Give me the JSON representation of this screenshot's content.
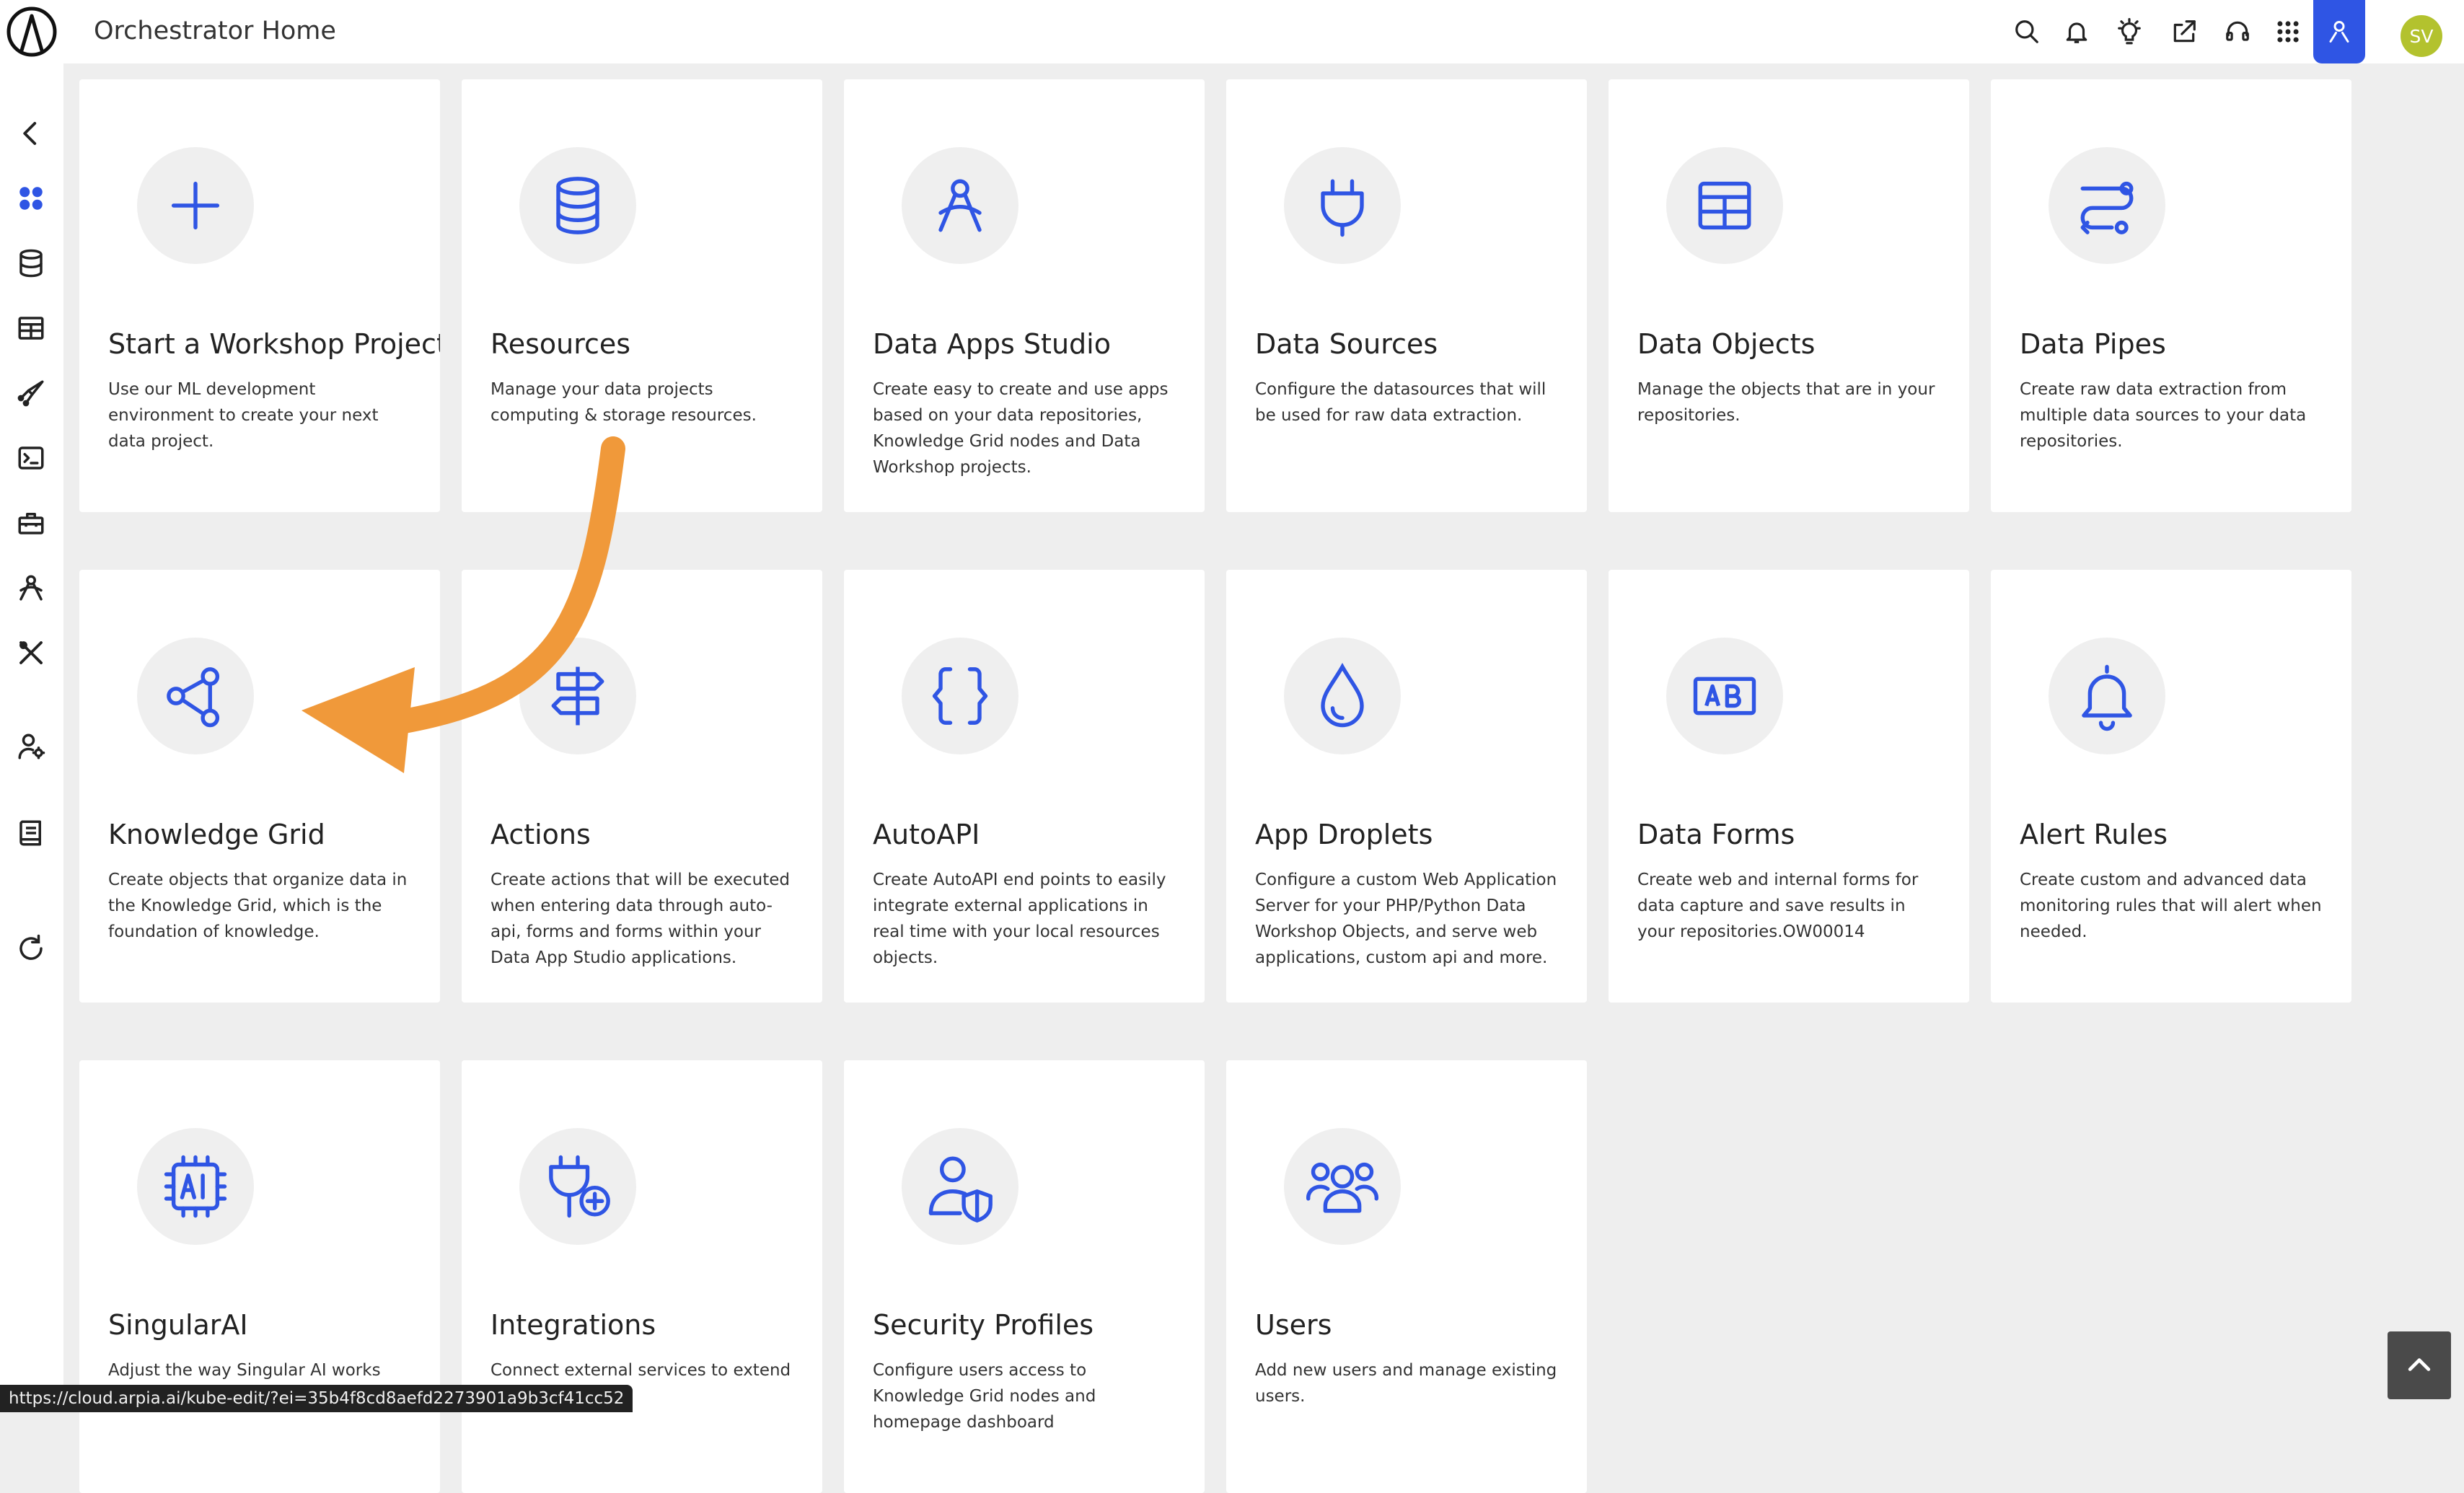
{
  "header": {
    "title": "Orchestrator Home",
    "icons": [
      "search-icon",
      "bell-icon",
      "lightbulb-icon",
      "share-icon",
      "headset-icon",
      "apps-grid-icon"
    ],
    "active_user_icon": "user-network-icon",
    "avatar_initials": "SV",
    "accent_color": "#2f55e4",
    "avatar_color": "#b3c22e"
  },
  "sidebar": {
    "items": [
      "collapse-icon",
      "dashboard-icon",
      "database-icon",
      "table-icon",
      "pipeline-icon",
      "terminal-icon",
      "toolbox-icon",
      "studio-icon",
      "tools-icon",
      "user-settings-icon",
      "book-icon",
      "refresh-icon"
    ]
  },
  "cards": [
    {
      "title": "Start a Workshop Project",
      "desc": "Use our ML development environment to create your next data project.",
      "icon": "plus-icon"
    },
    {
      "title": "Resources",
      "desc": "Manage your data projects computing & storage resources.",
      "icon": "database-icon"
    },
    {
      "title": "Data Apps Studio",
      "desc": "Create easy to create and use apps based on your data repositories, Knowledge Grid nodes and Data Workshop projects.",
      "icon": "compass-icon"
    },
    {
      "title": "Data Sources",
      "desc": "Configure the datasources that will be used for raw data extraction.",
      "icon": "plug-icon"
    },
    {
      "title": "Data Objects",
      "desc": "Manage the objects that are in your repositories.",
      "icon": "table-icon"
    },
    {
      "title": "Data Pipes",
      "desc": "Create raw data extraction from multiple data sources to your data repositories.",
      "icon": "route-icon"
    },
    {
      "title": "Knowledge Grid",
      "desc": "Create objects that organize data in the Knowledge Grid, which is the foundation of knowledge.",
      "icon": "share-nodes-icon"
    },
    {
      "title": "Actions",
      "desc": "Create actions that will be executed when entering data through auto-api, forms and forms within your Data App Studio applications.",
      "icon": "signpost-icon"
    },
    {
      "title": "AutoAPI",
      "desc": "Create AutoAPI end points to easily integrate external applications in real time with your local resources objects.",
      "icon": "braces-icon"
    },
    {
      "title": "App Droplets",
      "desc": "Configure a custom Web Application Server for your PHP/Python Data Workshop Objects, and serve web applications, custom api and more.",
      "icon": "droplet-icon"
    },
    {
      "title": "Data Forms",
      "desc": "Create web and internal forms for data capture and save results in your repositories.OW00014",
      "icon": "ab-form-icon"
    },
    {
      "title": "Alert Rules",
      "desc": "Create custom and advanced data monitoring rules that will alert when needed.",
      "icon": "bell-icon"
    },
    {
      "title": "SingularAI",
      "desc": "Adjust the way Singular AI works with",
      "icon": "ai-chip-icon"
    },
    {
      "title": "Integrations",
      "desc": "Connect external services to extend alities.",
      "icon": "plug-plus-icon"
    },
    {
      "title": "Security Profiles",
      "desc": "Configure users access to Knowledge Grid nodes and homepage dashboard",
      "icon": "user-shield-icon"
    },
    {
      "title": "Users",
      "desc": "Add new users and manage existing users.",
      "icon": "users-icon"
    }
  ],
  "status_url": "https://cloud.arpia.ai/kube-edit/?ei=35b4f8cd8aefd2273901a9b3cf41cc52",
  "annotation_color": "#f0993a"
}
